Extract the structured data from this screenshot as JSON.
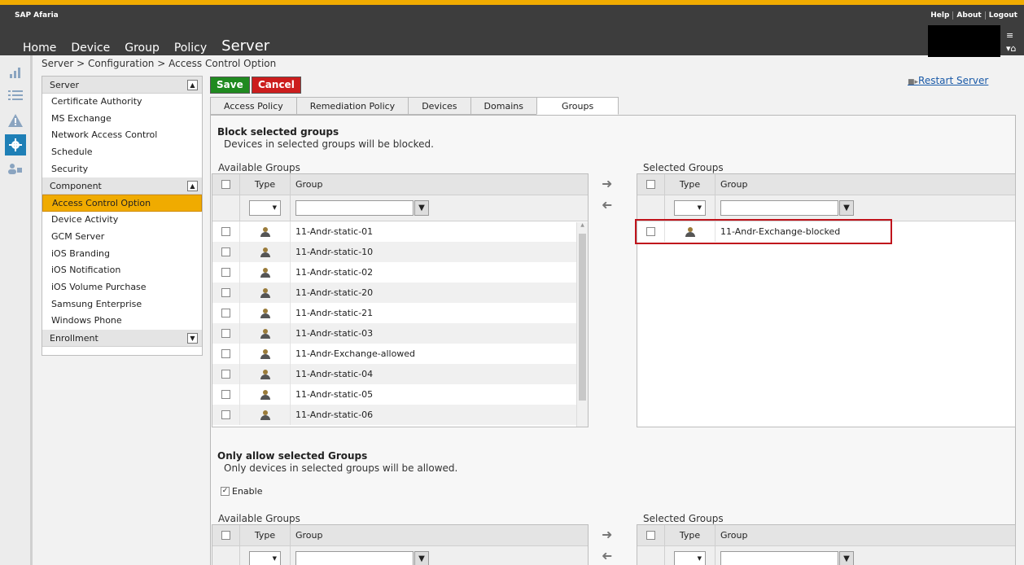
{
  "app": {
    "title": "SAP Afaria"
  },
  "top_links": [
    "Help",
    "About",
    "Logout"
  ],
  "main_nav": [
    {
      "label": "Home"
    },
    {
      "label": "Device"
    },
    {
      "label": "Group"
    },
    {
      "label": "Policy"
    },
    {
      "label": "Server",
      "active": true
    }
  ],
  "breadcrumb": "Server > Configuration > Access Control Option",
  "sidebar": {
    "sections": [
      {
        "title": "Server",
        "items": [
          "Certificate Authority",
          "MS Exchange",
          "Network Access Control",
          "Schedule",
          "Security"
        ]
      },
      {
        "title": "Component",
        "items": [
          "Access Control Option",
          "Device Activity",
          "GCM Server",
          "iOS Branding",
          "iOS Notification",
          "iOS Volume Purchase",
          "Samsung Enterprise",
          "Windows Phone"
        ],
        "active_item": "Access Control Option"
      },
      {
        "title": "Enrollment",
        "items": []
      }
    ]
  },
  "toolbar": {
    "save_label": "Save",
    "cancel_label": "Cancel",
    "restart_label": "Restart Server"
  },
  "tabs": [
    "Access Policy",
    "Remediation Policy",
    "Devices",
    "Domains",
    "Groups"
  ],
  "active_tab": "Groups",
  "block": {
    "title": "Block selected groups",
    "description": "Devices in selected groups will be blocked.",
    "available_label": "Available Groups",
    "selected_label": "Selected Groups",
    "columns": {
      "type": "Type",
      "group": "Group"
    },
    "available_rows": [
      "11-Andr-static-01",
      "11-Andr-static-10",
      "11-Andr-static-02",
      "11-Andr-static-20",
      "11-Andr-static-21",
      "11-Andr-static-03",
      "11-Andr-Exchange-allowed",
      "11-Andr-static-04",
      "11-Andr-static-05",
      "11-Andr-static-06"
    ],
    "selected_rows": [
      "11-Andr-Exchange-blocked"
    ]
  },
  "allow": {
    "title": "Only allow selected Groups",
    "description": "Only devices in selected groups will be allowed.",
    "enable_label": "Enable",
    "available_label": "Available Groups",
    "selected_label": "Selected Groups",
    "columns": {
      "type": "Type",
      "group": "Group"
    }
  },
  "colors": {
    "accent": "#f0ab00",
    "topbar": "#3d3d3d",
    "save": "#1f8a1f",
    "cancel": "#cc1d1d",
    "highlight": "#c0141c"
  }
}
